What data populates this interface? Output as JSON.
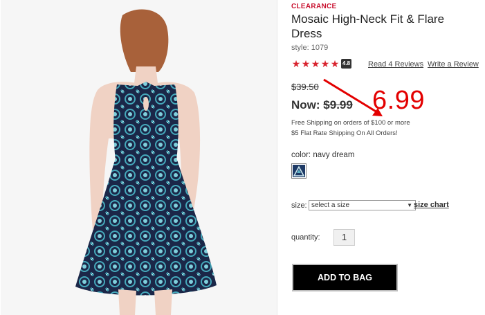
{
  "product": {
    "badge": "CLEARANCE",
    "title": "Mosaic High-Neck Fit & Flare Dress",
    "style": "style: 1079",
    "rating": {
      "stars": 5,
      "value": "4.8",
      "read_reviews": "Read 4 Reviews",
      "write_review": "Write a Review"
    },
    "price": {
      "was": "$39.50",
      "now_label": "Now:",
      "now_value": "$9.99",
      "annotated_price": "6.99"
    },
    "shipping": {
      "line1": "Free Shipping on orders of $100 or more",
      "line2": "$5 Flat Rate Shipping On All Orders!"
    },
    "color": {
      "label": "color:",
      "value": "navy dream"
    },
    "size": {
      "label": "size:",
      "selected": "select a size",
      "chart_link": "size chart"
    },
    "quantity": {
      "label": "quantity:",
      "value": "1"
    },
    "add_button": "ADD TO BAG"
  },
  "colors": {
    "accent_red": "#d9242f",
    "annotation_red": "#e30000",
    "dress_navy": "#1e2a4a",
    "dress_teal": "#3fa3b5"
  }
}
